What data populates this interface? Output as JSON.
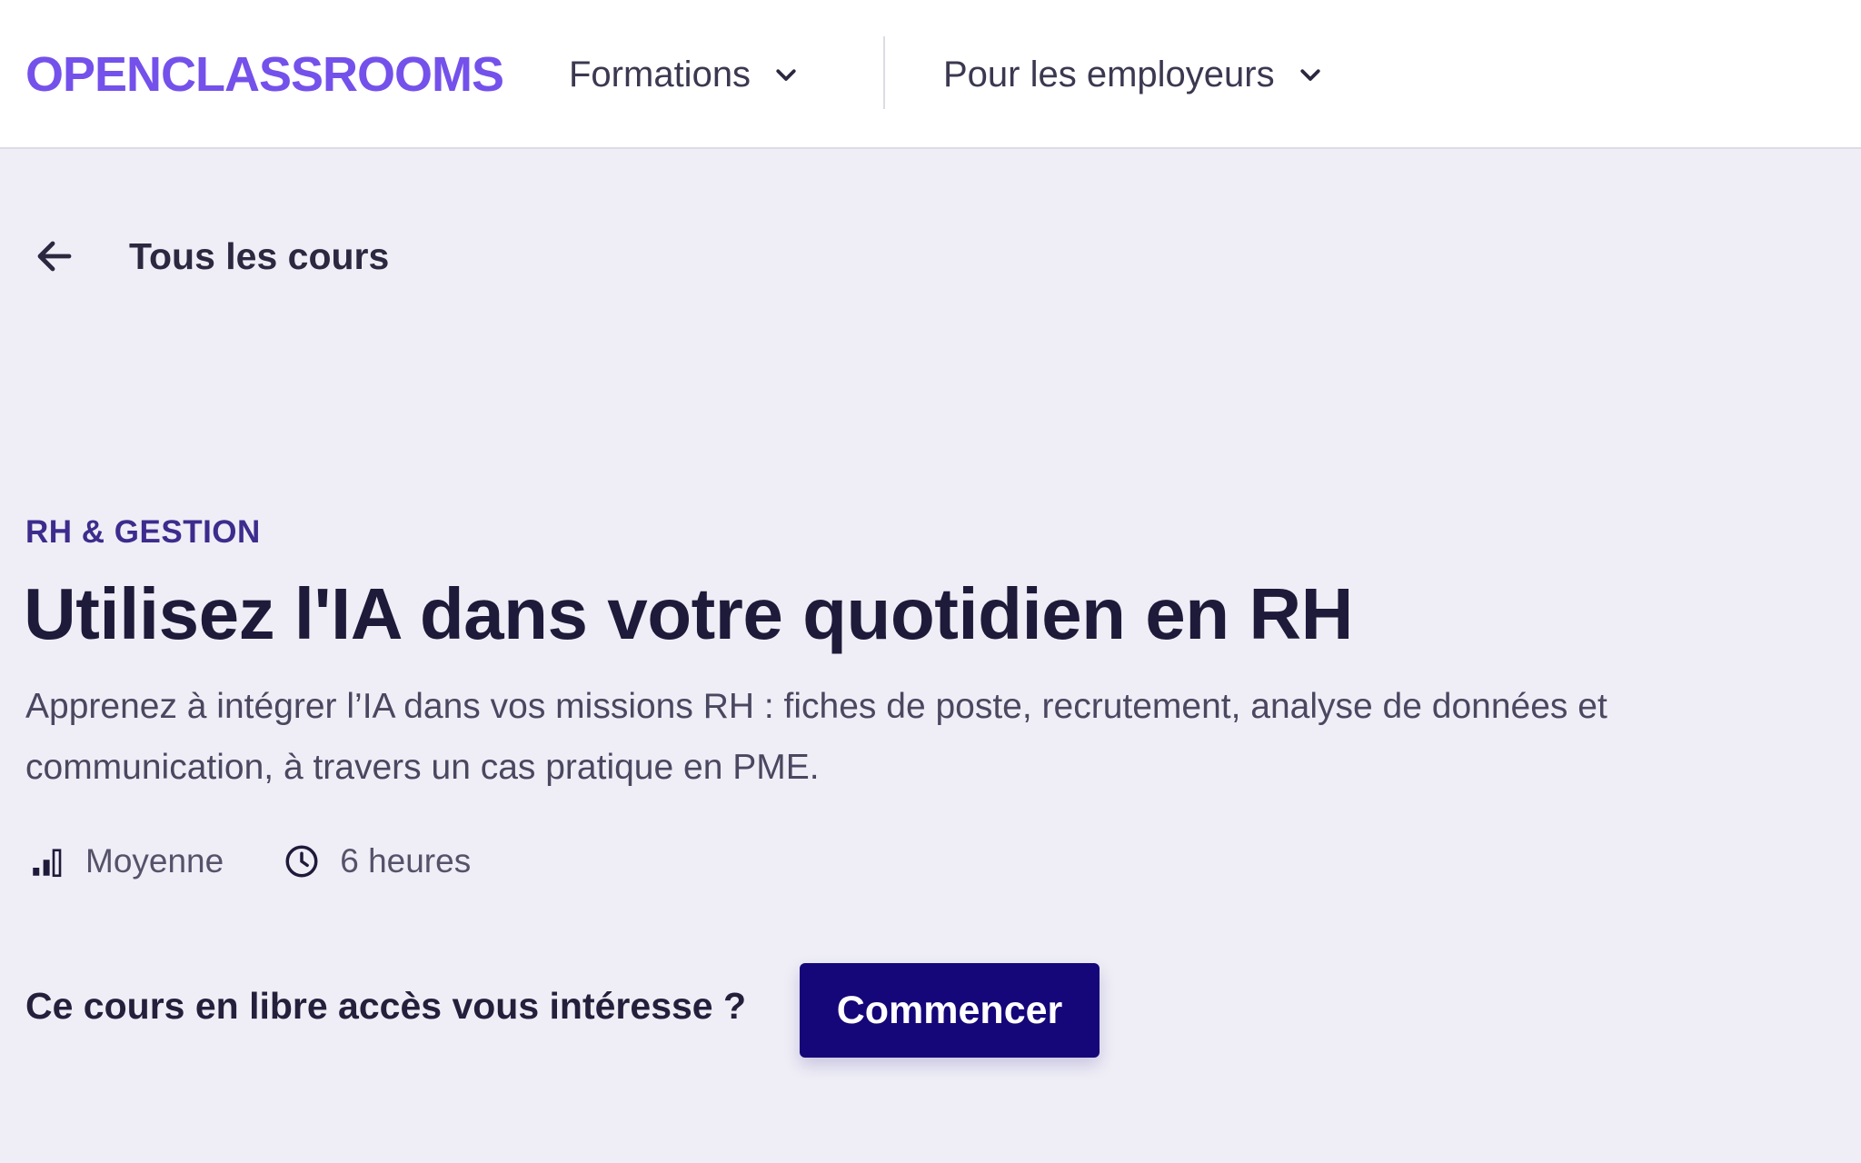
{
  "header": {
    "logo_text": "OPENCLASSROOMS",
    "nav": [
      {
        "label": "Formations",
        "icon": "chevron-down-icon"
      },
      {
        "label": "Pour les employeurs",
        "icon": "chevron-down-icon"
      }
    ]
  },
  "breadcrumb": {
    "back_label": "Tous les cours",
    "icon": "arrow-left-icon"
  },
  "course": {
    "category": "RH & GESTION",
    "title": "Utilisez l'IA dans votre quotidien en RH",
    "description": "Apprenez à intégrer l’IA dans vos missions RH : fiches de poste, recrutement, analyse de données et communication, à travers un cas pratique en PME.",
    "difficulty": {
      "label": "Moyenne",
      "icon": "difficulty-bars-icon",
      "level": 2,
      "max_level": 3
    },
    "duration": {
      "label": "6 heures",
      "icon": "clock-icon"
    }
  },
  "cta": {
    "prompt": "Ce cours en libre accès vous intéresse ?",
    "button_label": "Commencer"
  },
  "colors": {
    "brand": "#7451eb",
    "primary_button": "#150779",
    "page_background": "#efeef6",
    "category": "#3d2c8d"
  }
}
